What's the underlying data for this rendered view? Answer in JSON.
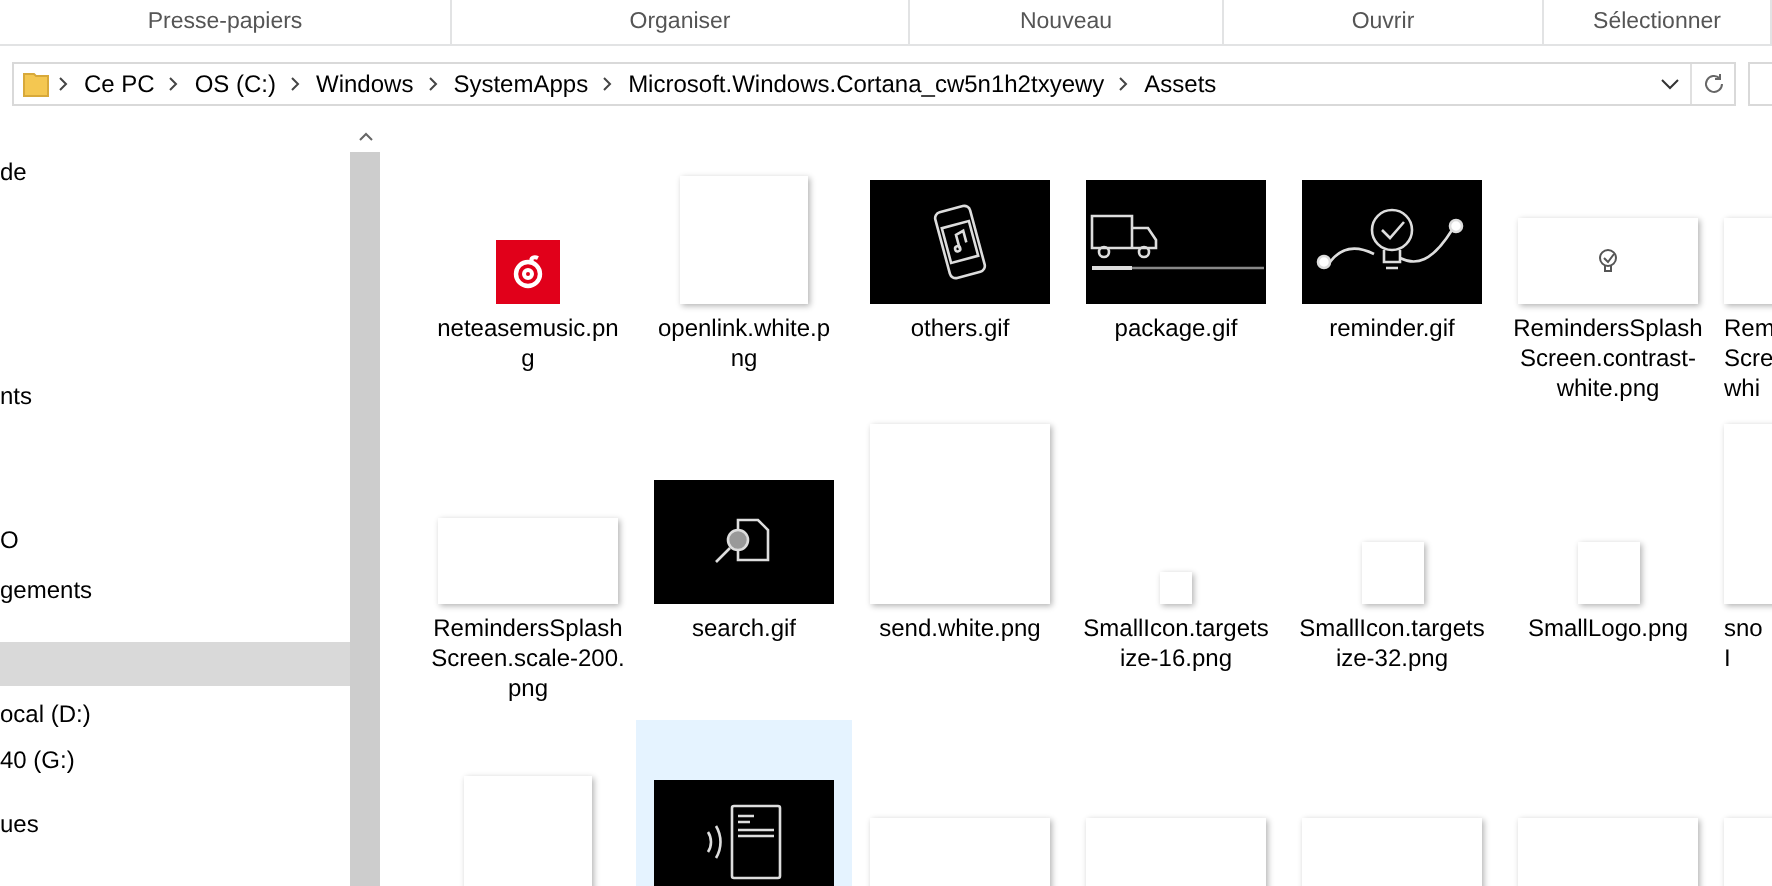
{
  "ribbon_groups": [
    "Presse-papiers",
    "Organiser",
    "Nouveau",
    "Ouvrir",
    "Sélectionner"
  ],
  "address_bar": {
    "crumbs": [
      "Ce PC",
      "OS (C:)",
      "Windows",
      "SystemApps",
      "Microsoft.Windows.Cortana_cw5n1h2txyewy",
      "Assets"
    ]
  },
  "nav_pane": {
    "items": [
      {
        "label": "de",
        "selected": false
      },
      {
        "label": "nts",
        "selected": false
      },
      {
        "label": "O",
        "selected": false
      },
      {
        "label": "gements",
        "selected": false
      },
      {
        "selected": true
      },
      {
        "label": "ocal (D:)",
        "selected": false
      },
      {
        "label": "40 (G:)",
        "selected": false
      },
      {
        "label": "ues",
        "selected": false
      }
    ]
  },
  "files": [
    {
      "label": "neteasemusic.pn\ng",
      "selected": false,
      "kind": "logo"
    },
    {
      "label": "openlink.white.p\nng",
      "selected": false,
      "kind": "square"
    },
    {
      "label": "others.gif",
      "selected": false,
      "kind": "watch"
    },
    {
      "label": "package.gif",
      "selected": false,
      "kind": "truck"
    },
    {
      "label": "reminder.gif",
      "selected": false,
      "kind": "reminder"
    },
    {
      "label": "RemindersSplash\nScreen.contrast-\nwhite.png",
      "selected": false,
      "kind": "note"
    },
    {
      "label": "Rem\nScre\nwhi",
      "selected": false,
      "kind": "banner"
    },
    {
      "label": "RemindersSplash\nScreen.scale-200.\npng",
      "selected": false,
      "kind": "banner"
    },
    {
      "label": "search.gif",
      "selected": false,
      "kind": "search"
    },
    {
      "label": "send.white.png",
      "selected": false,
      "kind": "large"
    },
    {
      "label": "SmallIcon.targets\nize-16.png",
      "selected": false,
      "kind": "tiny"
    },
    {
      "label": "SmallIcon.targets\nize-32.png",
      "selected": false,
      "kind": "small"
    },
    {
      "label": "SmallLogo.png",
      "selected": false,
      "kind": "small"
    },
    {
      "label": "sno\nI",
      "selected": false,
      "kind": "large"
    },
    {
      "selected": false,
      "kind": "square"
    },
    {
      "selected": true,
      "kind": "speech"
    },
    {
      "selected": false,
      "kind": "banner"
    },
    {
      "selected": false,
      "kind": "banner"
    },
    {
      "selected": false,
      "kind": "banner"
    },
    {
      "selected": false,
      "kind": "banner"
    },
    {
      "selected": false,
      "kind": "banner"
    }
  ]
}
